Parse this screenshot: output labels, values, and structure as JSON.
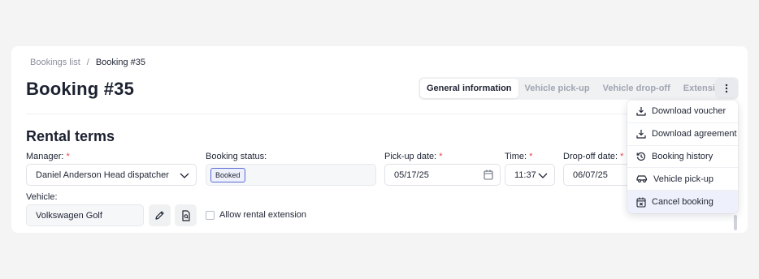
{
  "breadcrumb": {
    "parent": "Bookings list",
    "separator": "/",
    "current": "Booking #35"
  },
  "page_title": "Booking #35",
  "tabs": [
    {
      "label": "General information",
      "active": true
    },
    {
      "label": "Vehicle pick-up",
      "active": false
    },
    {
      "label": "Vehicle drop-off",
      "active": false
    },
    {
      "label": "Extensions",
      "active": false
    }
  ],
  "section_title": "Rental terms",
  "form": {
    "manager": {
      "label": "Manager:",
      "required": "*",
      "value": "Daniel Anderson Head dispatcher"
    },
    "status": {
      "label": "Booking status:",
      "value": "Booked"
    },
    "pickup_date": {
      "label": "Pick-up date:",
      "required": "*",
      "value": "05/17/25"
    },
    "time": {
      "label": "Time:",
      "required": "*",
      "value": "11:37"
    },
    "dropoff_date": {
      "label": "Drop-off date:",
      "required": "*",
      "value": "06/07/25"
    },
    "vehicle": {
      "label": "Vehicle:",
      "value": "Volkswagen Golf"
    },
    "allow_extension": {
      "label": "Allow rental extension",
      "checked": false
    }
  },
  "menu": {
    "items": [
      {
        "label": "Download voucher",
        "icon": "download-icon"
      },
      {
        "label": "Download agreement",
        "icon": "download-icon"
      },
      {
        "label": "Booking history",
        "icon": "history-icon"
      },
      {
        "label": "Vehicle pick-up",
        "icon": "car-icon"
      },
      {
        "label": "Cancel booking",
        "icon": "calendar-x-icon",
        "hovered": true
      }
    ]
  },
  "colors": {
    "required": "#e5484d",
    "badge_border": "#5b6bd6",
    "menu_hover": "#eef1fb"
  }
}
